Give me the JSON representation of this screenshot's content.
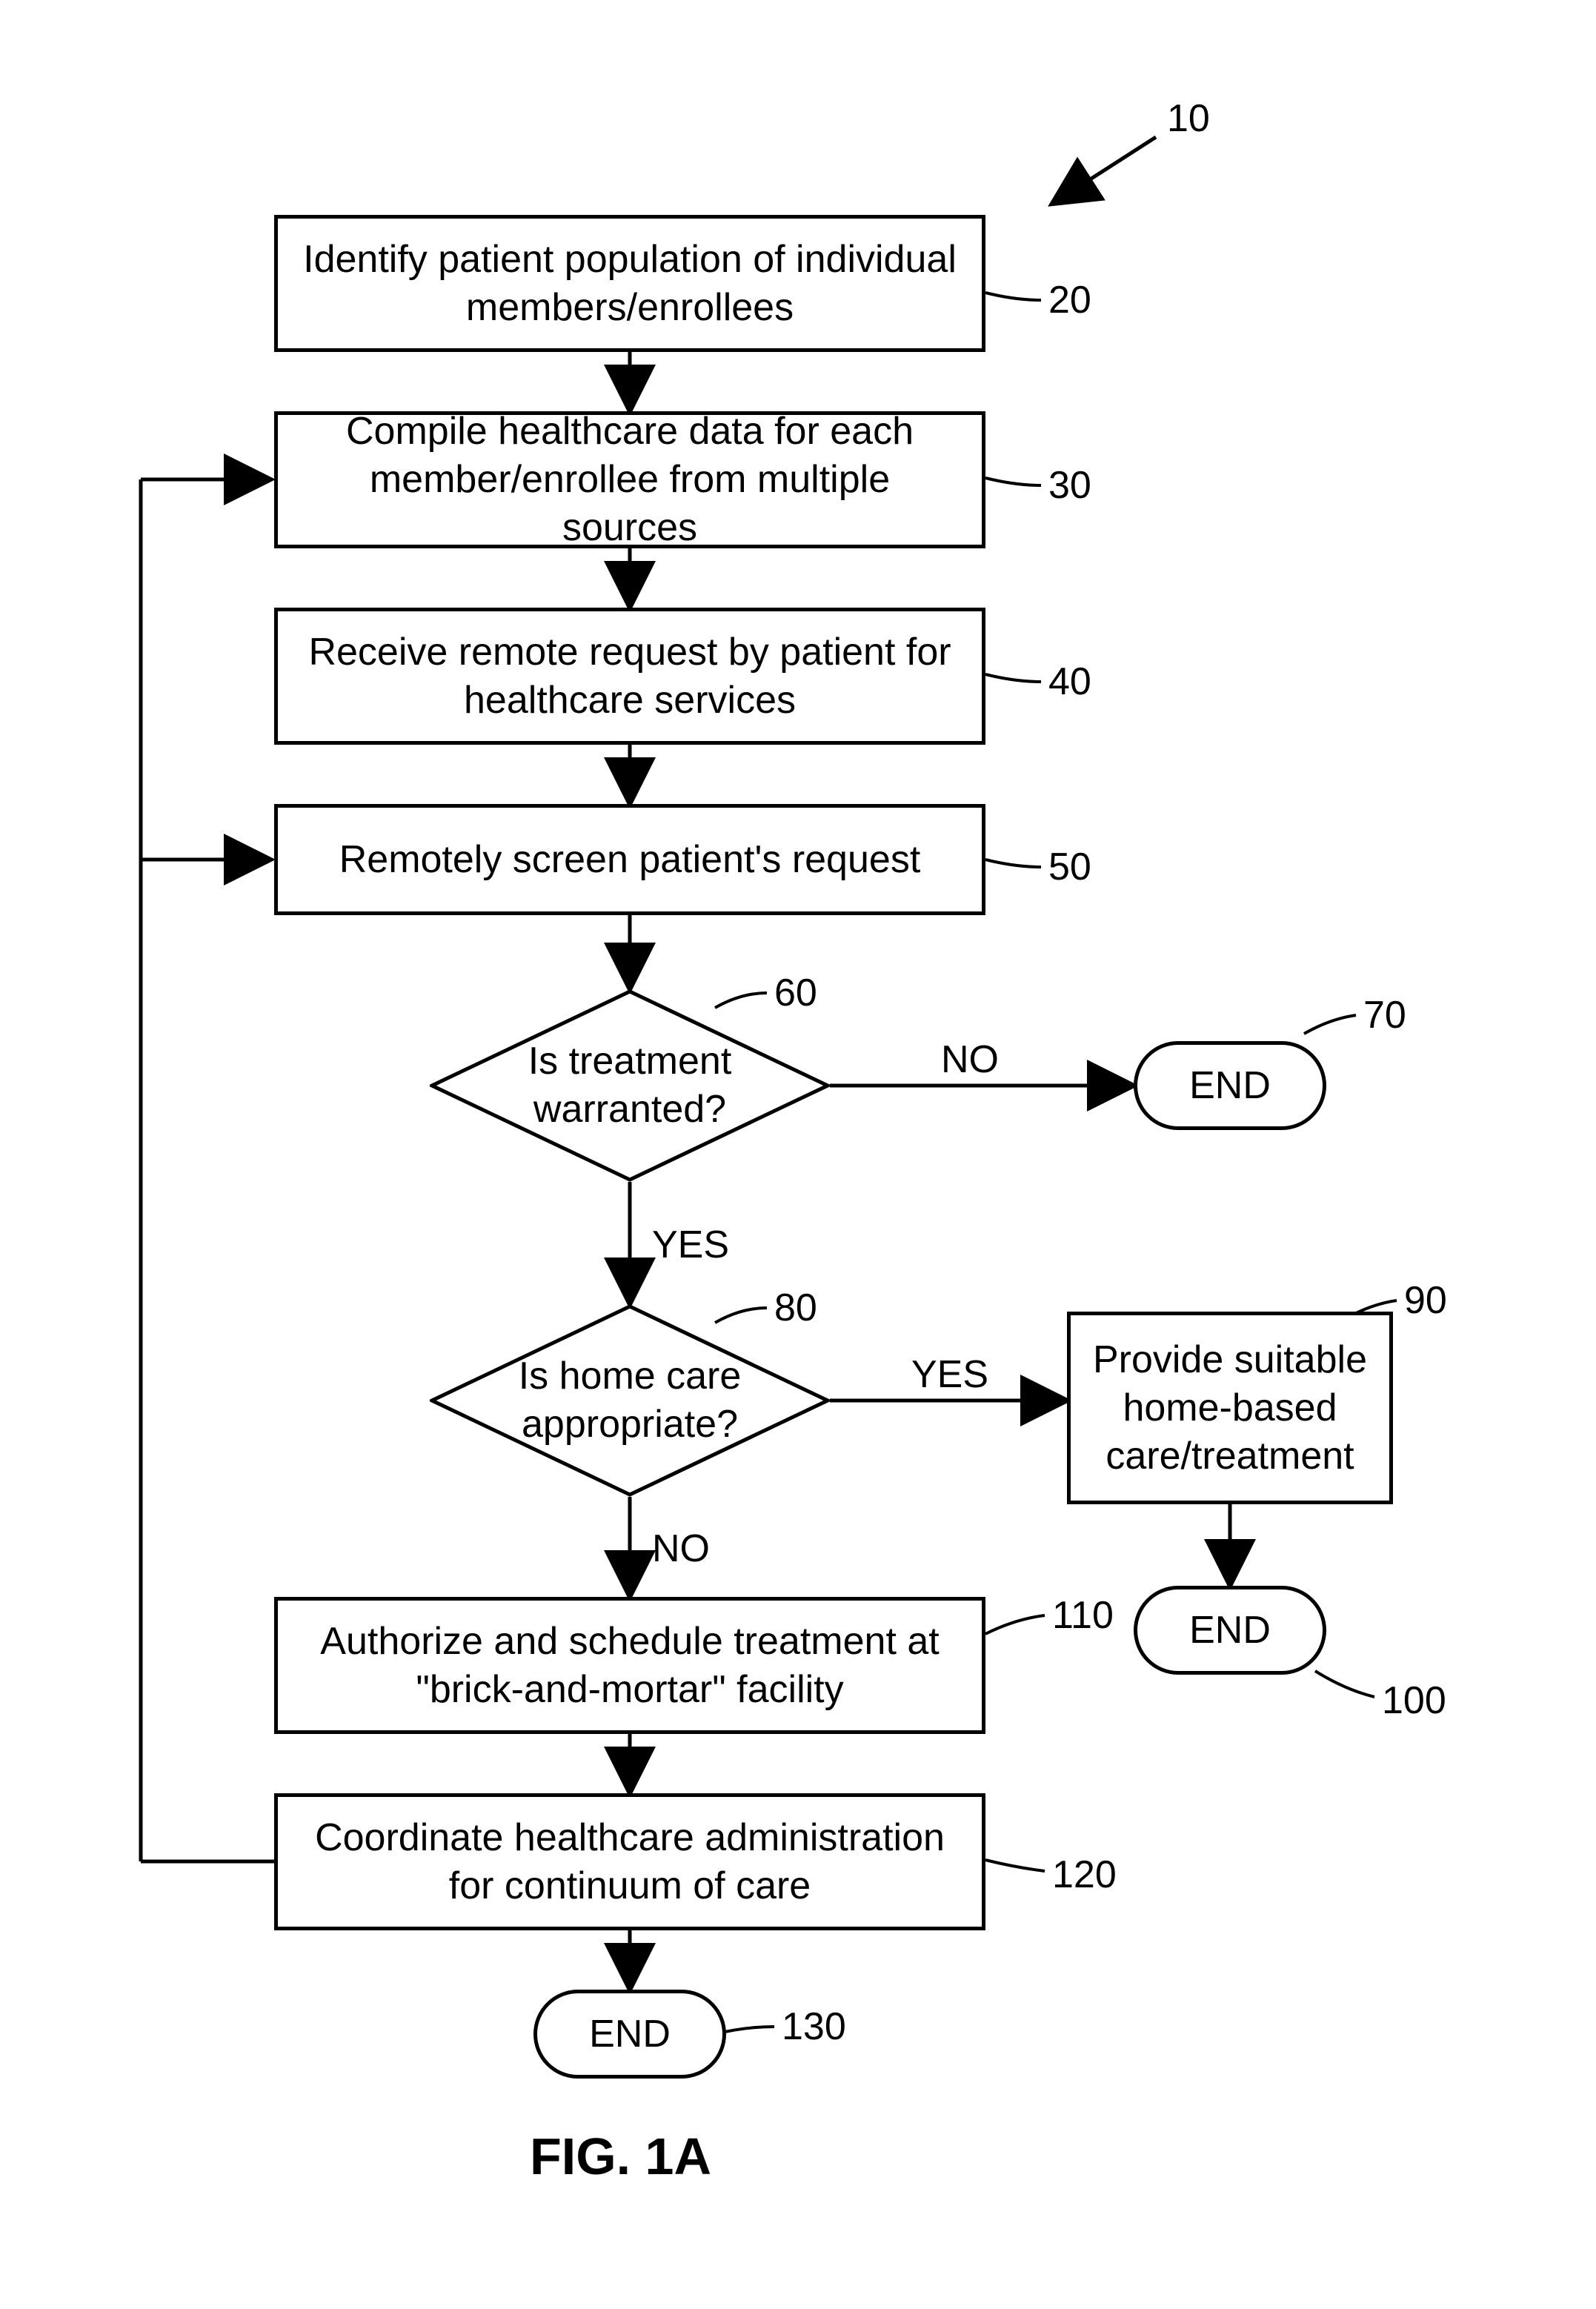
{
  "figure": {
    "caption": "FIG. 1A",
    "overall_ref": "10"
  },
  "nodes": {
    "n20": {
      "ref": "20",
      "text": "Identify patient population of individual members/enrollees"
    },
    "n30": {
      "ref": "30",
      "text": "Compile healthcare data for each member/enrollee from multiple sources"
    },
    "n40": {
      "ref": "40",
      "text": "Receive remote request by patient for healthcare services"
    },
    "n50": {
      "ref": "50",
      "text": "Remotely screen patient's request"
    },
    "n60": {
      "ref": "60",
      "text": "Is treatment warranted?"
    },
    "n70": {
      "ref": "70",
      "text": "END"
    },
    "n80": {
      "ref": "80",
      "text": "Is home care appropriate?"
    },
    "n90": {
      "ref": "90",
      "text": "Provide suitable home-based care/treatment"
    },
    "n100": {
      "ref": "100",
      "text": "END"
    },
    "n110": {
      "ref": "110",
      "text": "Authorize and schedule treatment at \"brick-and-mortar\" facility"
    },
    "n120": {
      "ref": "120",
      "text": "Coordinate healthcare administration for continuum of care"
    },
    "n130": {
      "ref": "130",
      "text": "END"
    }
  },
  "edges": {
    "d60_no": "NO",
    "d60_yes": "YES",
    "d80_yes": "YES",
    "d80_no": "NO"
  }
}
